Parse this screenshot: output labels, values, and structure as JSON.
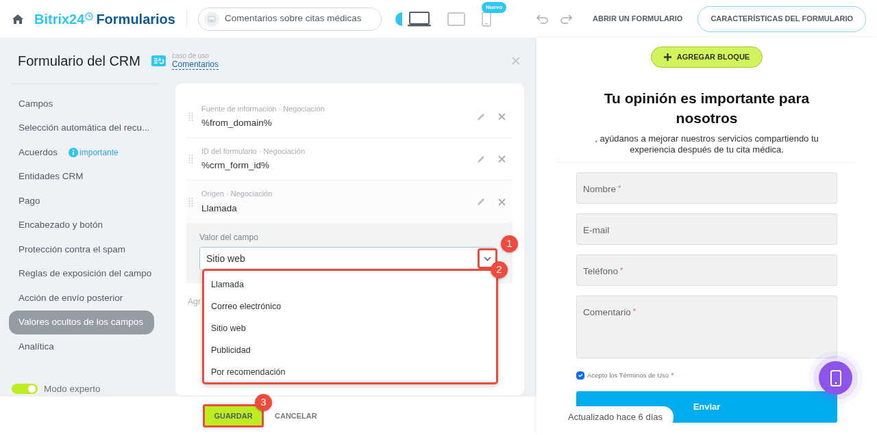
{
  "header": {
    "logo_brand": "Bitrix24",
    "logo_product": "Formularios",
    "form_name": "Comentarios sobre citas médicas",
    "devices": [
      {
        "kind": "desktop",
        "selected": true
      },
      {
        "kind": "tablet",
        "selected": false
      },
      {
        "kind": "phone",
        "selected": false,
        "badge": "Nuevo"
      }
    ],
    "links": [
      "ABRIR UN FORMULARIO"
    ],
    "primary_button": "CARACTERÍSTICAS DEL FORMULARIO"
  },
  "panel": {
    "title": "Formulario del CRM",
    "use_case_caption": "caso de uso",
    "use_case": "Comentarios"
  },
  "sidebar": {
    "items": [
      {
        "label": "Campos",
        "selected": false
      },
      {
        "label": "Selección automática del recu...",
        "selected": false
      },
      {
        "label": "Acuerdos",
        "selected": false,
        "badge": "importante"
      },
      {
        "label": "Entidades CRM",
        "selected": false
      },
      {
        "label": "Pago",
        "selected": false
      },
      {
        "label": "Encabezado y botón",
        "selected": false
      },
      {
        "label": "Protección contra el spam",
        "selected": false
      },
      {
        "label": "Reglas de exposición del campo",
        "selected": false
      },
      {
        "label": "Acción de envío posterior",
        "selected": false
      },
      {
        "label": "Valores ocultos de los campos",
        "selected": true
      },
      {
        "label": "Analítica",
        "selected": false
      }
    ],
    "expert_mode": {
      "label": "Modo experto",
      "on": true
    }
  },
  "fields": [
    {
      "label": "Fuente de información · Negociación",
      "value": "%from_domain%",
      "expanded": false
    },
    {
      "label": "ID del formulario · Negociación",
      "value": "%crm_form_id%",
      "expanded": false
    },
    {
      "label": "Origen · Negociación",
      "value": "Llamada",
      "expanded": true,
      "editor": {
        "label": "Valor del campo",
        "value": "Sitio web",
        "callout": "1",
        "dropdown": {
          "open": true,
          "callout": "2",
          "options": [
            "Llamada",
            "Correo electrónico",
            "Sitio web",
            "Publicidad",
            "Por recomendación"
          ]
        }
      }
    }
  ],
  "add_link": "Agr",
  "footer": {
    "save": "GUARDAR",
    "save_callout": "3",
    "cancel": "CANCELAR"
  },
  "preview": {
    "add_block": "AGREGAR BLOQUE",
    "title": "Tu opinión es importante para nosotros",
    "subtitle": ", ayúdanos a mejorar nuestros servicios compartiendo tu experiencia después de tu cita médica.",
    "inputs": [
      {
        "kind": "input",
        "placeholder": "Nombre",
        "required_mark": "*"
      },
      {
        "kind": "input",
        "placeholder": "E-mail"
      },
      {
        "kind": "input",
        "placeholder": "Teléfono",
        "required_mark": "*"
      },
      {
        "kind": "textarea",
        "placeholder": "Comentario",
        "required_mark": "*"
      }
    ],
    "consent": {
      "label": "Acepto los Términos de Uso",
      "checked": true,
      "required_mark": "*"
    },
    "submit": "Enviar",
    "status": "Actualizado hace 6 días"
  }
}
